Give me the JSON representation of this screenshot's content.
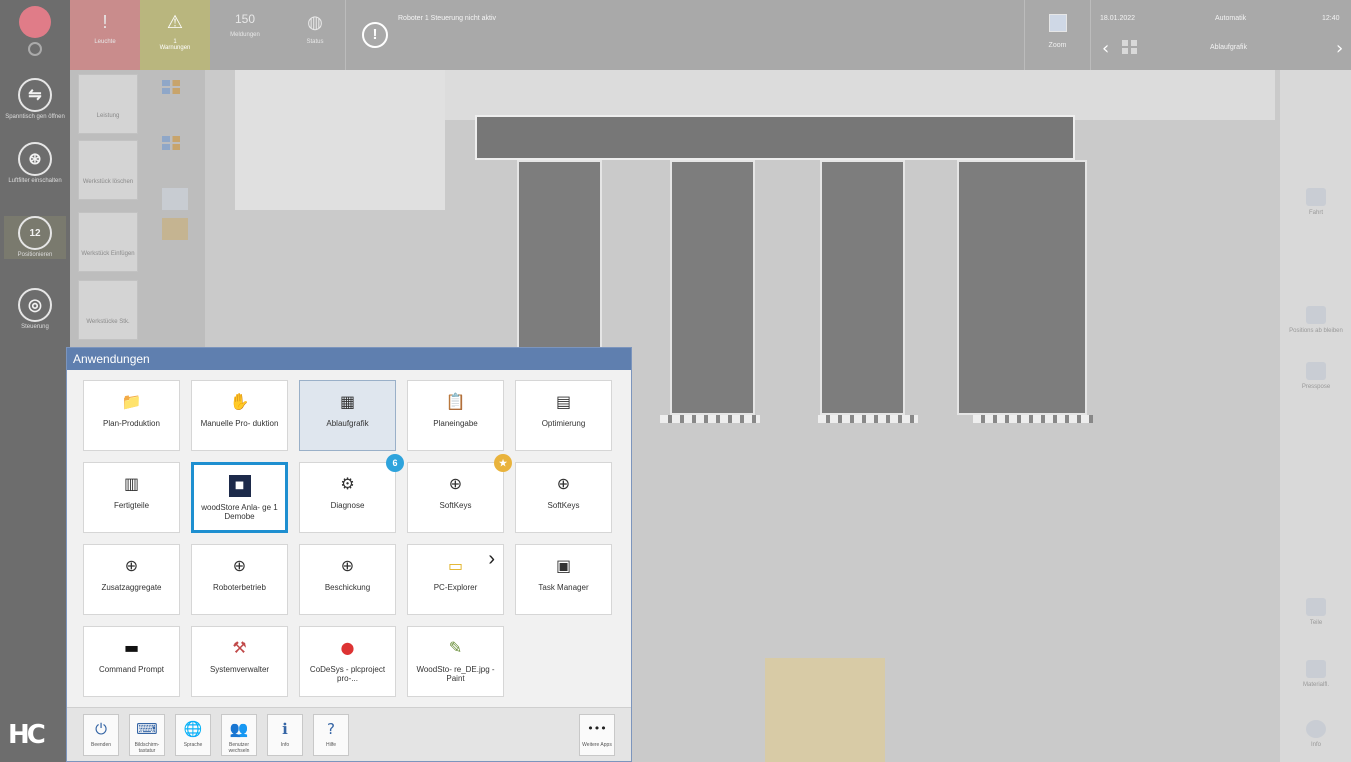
{
  "top_bar": {
    "tabs": [
      {
        "id": "alarm",
        "label": "Leuchte",
        "glyph": "!"
      },
      {
        "id": "warning",
        "label": "Warnungen",
        "count": "1",
        "glyph": "⚠"
      },
      {
        "id": "count",
        "label": "Meldungen",
        "count": "150"
      },
      {
        "id": "globe",
        "label": "Status"
      }
    ],
    "alert_text": "Roboter 1 Steuerung nicht aktiv",
    "zoom_label": "Zoom",
    "date": "18.01.2022",
    "mode": "Automatik",
    "view": "Ablaufgrafik",
    "time": "12:40"
  },
  "left_rail": {
    "items": [
      {
        "label": "Spanntisch gen öffnen",
        "glyph": "⇋"
      },
      {
        "label": "Luftfilter einschalten",
        "glyph": "⊛"
      },
      {
        "label": "Positionieren",
        "glyph": "12"
      },
      {
        "label": "Steuerung",
        "glyph": "◎"
      }
    ]
  },
  "secondary": {
    "cards": [
      {
        "label": "Leistung"
      },
      {
        "label": "Werkstück löschen"
      },
      {
        "label": "Werkstück Einfügen"
      },
      {
        "label": "Werkstücke Stk."
      }
    ]
  },
  "apps": {
    "title": "Anwendungen",
    "tiles": [
      {
        "label": "Plan-Produktion",
        "glyph": "📁"
      },
      {
        "label": "Manuelle Pro- duktion",
        "glyph": "✋"
      },
      {
        "label": "Ablaufgrafik",
        "glyph": "▦"
      },
      {
        "label": "Planeingabe",
        "glyph": "📋"
      },
      {
        "label": "Optimierung",
        "glyph": "▤"
      },
      {
        "label": "Fertigteile",
        "glyph": "▥"
      },
      {
        "label": "woodStore Anla- ge 1 Demobe",
        "glyph": "■"
      },
      {
        "label": "Diagnose",
        "glyph": "⚙",
        "badge": "6"
      },
      {
        "label": "SoftKeys",
        "glyph": "⊕",
        "badge": "★"
      },
      {
        "label": "SoftKeys",
        "glyph": "⊕"
      },
      {
        "label": "Zusatzaggregate",
        "glyph": "⊕"
      },
      {
        "label": "Roboterbetrieb",
        "glyph": "⊕"
      },
      {
        "label": "Beschickung",
        "glyph": "⊕"
      },
      {
        "label": "PC-Explorer",
        "glyph": "▭",
        "arrow": "›"
      },
      {
        "label": "Task Manager",
        "glyph": "▣"
      },
      {
        "label": "Command Prompt",
        "glyph": "▬"
      },
      {
        "label": "Systemverwalter",
        "glyph": "⚒"
      },
      {
        "label": "CoDeSys - plcproject pro-...",
        "glyph": "●"
      },
      {
        "label": "WoodSto- re_DE.jpg - Paint",
        "glyph": "✎"
      }
    ],
    "bottom": [
      {
        "label": "Beenden",
        "glyph": "⏻"
      },
      {
        "label": "Bildschirm- tastatur",
        "glyph": "⌨"
      },
      {
        "label": "Sprache",
        "glyph": "🌐"
      },
      {
        "label": "Benutzer wechseln",
        "glyph": "👥"
      },
      {
        "label": "Info",
        "glyph": "ℹ"
      },
      {
        "label": "Hilfe",
        "glyph": "?"
      },
      {
        "label": "Weitere Apps",
        "glyph": "•••"
      }
    ]
  },
  "right_panel": {
    "items": [
      {
        "label": "Fahrt"
      },
      {
        "label": "Positions ab bleiben"
      },
      {
        "label": "Presspose"
      },
      {
        "label": "Teile"
      },
      {
        "label": "Materialfl."
      },
      {
        "label": "Info"
      }
    ]
  },
  "colors": {
    "accent": "#1e8fd0",
    "header": "#5f7faf",
    "badge_blue": "#2ea3dc",
    "badge_gold": "#e9b33c"
  }
}
